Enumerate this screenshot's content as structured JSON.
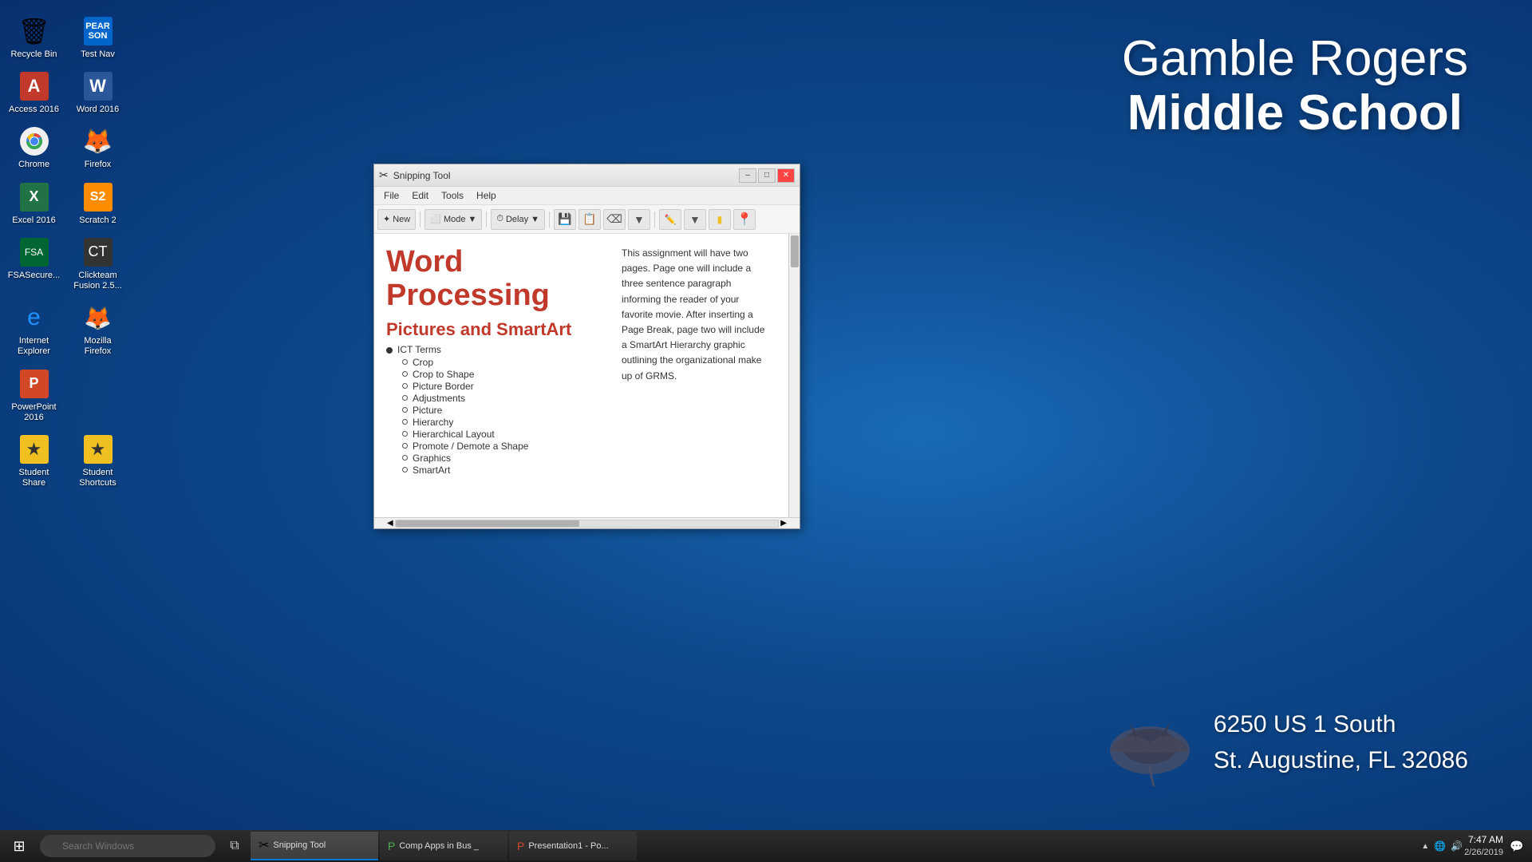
{
  "desktop": {
    "background_color": "#1a5ca8"
  },
  "school": {
    "name_line1": "Gamble Rogers",
    "name_line2": "Middle School",
    "address_line1": "6250 US 1 South",
    "address_line2": "St. Augustine, FL 32086"
  },
  "desktop_icons": [
    {
      "id": "recycle-bin",
      "label": "Recycle Bin",
      "icon": "🗑️"
    },
    {
      "id": "pearson",
      "label": "Test Nav",
      "icon": "P"
    },
    {
      "id": "access-2016",
      "label": "Access 2016",
      "icon": "A"
    },
    {
      "id": "word-2016",
      "label": "Word 2016",
      "icon": "W"
    },
    {
      "id": "chrome",
      "label": "Chrome",
      "icon": "🌐"
    },
    {
      "id": "firefox",
      "label": "Firefox",
      "icon": "🦊"
    },
    {
      "id": "excel-2016",
      "label": "Excel 2016",
      "icon": "X"
    },
    {
      "id": "scratch2",
      "label": "Scratch 2",
      "icon": "S"
    },
    {
      "id": "fsasecure",
      "label": "FSASecure...",
      "icon": "F"
    },
    {
      "id": "clickteam",
      "label": "Clickteam Fusion 2.5...",
      "icon": "C"
    },
    {
      "id": "ie",
      "label": "Internet Explorer",
      "icon": "e"
    },
    {
      "id": "mozilla",
      "label": "Mozilla Firefox",
      "icon": "🦊"
    },
    {
      "id": "ppt2016",
      "label": "PowerPoint 2016",
      "icon": "P"
    },
    {
      "id": "student-share",
      "label": "Student Share",
      "icon": "★"
    },
    {
      "id": "student-shortcuts",
      "label": "Student Shortcuts",
      "icon": "★"
    }
  ],
  "snipping_tool": {
    "title": "Snipping Tool",
    "menus": [
      "File",
      "Edit",
      "Tools",
      "Help"
    ],
    "toolbar": {
      "new_label": "New",
      "mode_label": "Mode",
      "delay_label": "Delay"
    },
    "document": {
      "title_word": "Word",
      "title_processing": "Processing",
      "subtitle": "Pictures and SmartArt",
      "body_text": "This assignment will have two pages.  Page one will include a three sentence paragraph informing the reader of your favorite movie.  After inserting a Page Break, page two will include a SmartArt Hierarchy graphic outlining the organizational make up of GRMS.",
      "ict_terms_label": "ICT Terms",
      "bullet_items": [
        "Crop",
        "Crop to Shape",
        "Picture Border",
        "Adjustments",
        "Picture",
        "Hierarchy",
        "Hierarchical Layout",
        "Promote / Demote a Shape",
        "Graphics",
        "SmartArt"
      ]
    }
  },
  "taskbar": {
    "time": "7:47 AM",
    "date": "2/26/2019",
    "apps": [
      {
        "id": "snipping-tool",
        "label": "Snipping Tool",
        "active": true
      },
      {
        "id": "comp-apps",
        "label": "Comp Apps in Bus _",
        "active": false
      },
      {
        "id": "presentation",
        "label": "Presentation1 - Po...",
        "active": false
      }
    ]
  }
}
